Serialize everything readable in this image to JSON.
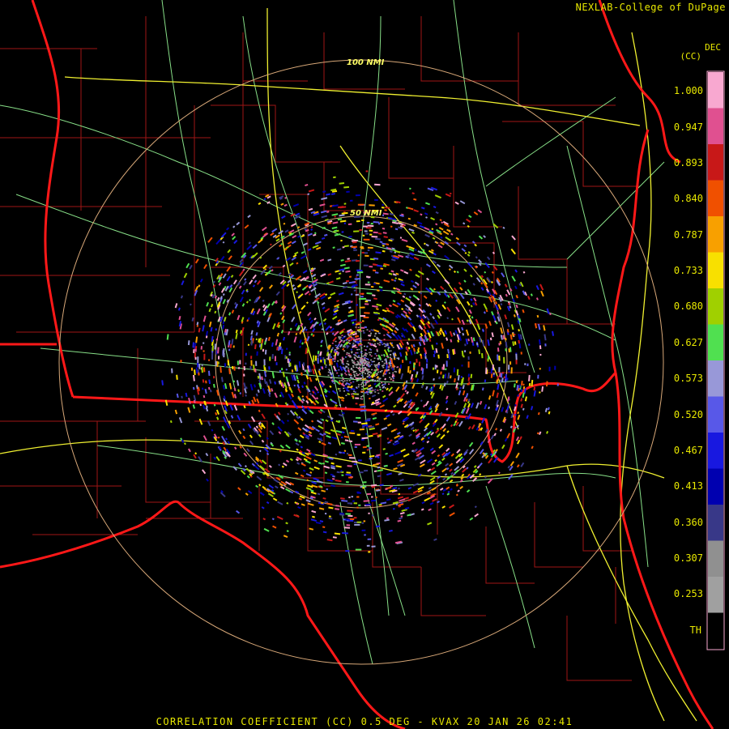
{
  "credit": "NEXLAB-College of DuPage",
  "footer": "CORRELATION COEFFICIENT (CC) 0.5 DEG - KVAX 20 JAN 26 02:41",
  "colorbar": {
    "unit_line1": "DEC",
    "unit_line2": "(CC)",
    "labels": [
      "1.000",
      "0.947",
      "0.893",
      "0.840",
      "0.787",
      "0.733",
      "0.680",
      "0.627",
      "0.573",
      "0.520",
      "0.467",
      "0.413",
      "0.360",
      "0.307",
      "0.253",
      "TH"
    ],
    "stops": [
      {
        "color": "#f8a8d0"
      },
      {
        "color": "#e05090"
      },
      {
        "color": "#c81818"
      },
      {
        "color": "#f05000"
      },
      {
        "color": "#f8a000"
      },
      {
        "color": "#f8e000"
      },
      {
        "color": "#a0d000"
      },
      {
        "color": "#50e050"
      },
      {
        "color": "#9898d8"
      },
      {
        "color": "#5858e8"
      },
      {
        "color": "#1818e0"
      },
      {
        "color": "#0000b0"
      },
      {
        "color": "#383888"
      },
      {
        "color": "#909090"
      },
      {
        "color": "#a0a0a0"
      },
      {
        "color": "#000000"
      }
    ]
  },
  "range_rings": [
    {
      "label": "50 NMI"
    },
    {
      "label": "100 NMI"
    }
  ],
  "colors": {
    "state_border": "#ff1818",
    "county_border": "#b01818",
    "interstate": "#ffff40",
    "highway": "#90e890",
    "ring": "#d8a878",
    "text": "#e8e800"
  }
}
